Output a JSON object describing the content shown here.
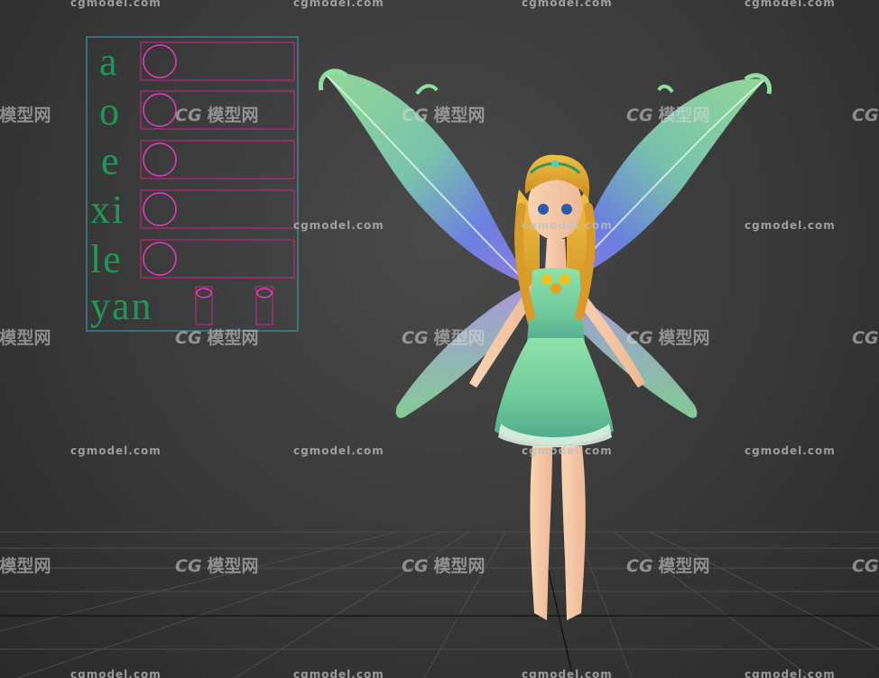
{
  "viewport": {
    "kind": "3D modeling viewport",
    "grid": true
  },
  "watermarks": {
    "site_text": "cgmodel.com",
    "cn_text": "模型网",
    "cn_logo": "CG"
  },
  "morph_rig": {
    "labels": [
      "a",
      "o",
      "e",
      "xi",
      "le",
      "yan"
    ],
    "control_count": 5,
    "eye_control_count": 2
  },
  "character": {
    "description": "fairy",
    "colors": {
      "hair": "#e0a428",
      "dress": "#7ccf9a",
      "wings_top": "#8fe0a0",
      "wings_mid": "#6a8df0",
      "skin": "#f4c7a4"
    }
  },
  "colors": {
    "bg_center": "#4a4a4a",
    "bg_edge": "#2a2a2a",
    "rig_frame": "#3aa6b4",
    "rig_control": "#d0258a",
    "rig_text": "#1f9a55"
  }
}
